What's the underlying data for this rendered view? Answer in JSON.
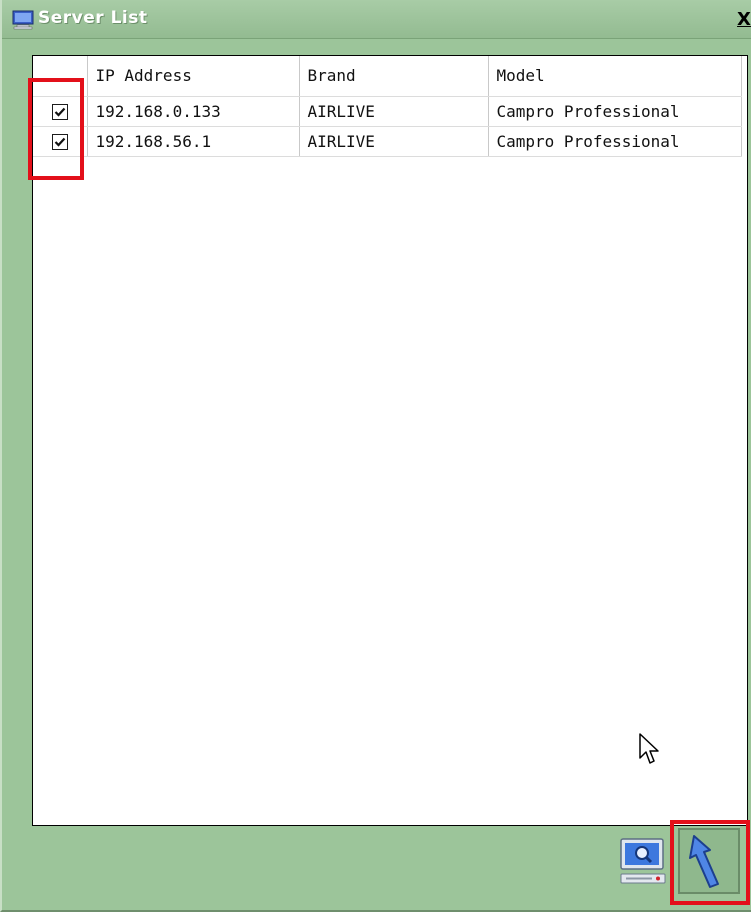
{
  "window": {
    "title": "Server List",
    "close_label": "X"
  },
  "table": {
    "columns": [
      "",
      "IP Address",
      "Brand",
      "Model"
    ],
    "rows": [
      {
        "checked": true,
        "ip": "192.168.0.133",
        "brand": "AIRLIVE",
        "model": "Campro Professional"
      },
      {
        "checked": true,
        "ip": "192.168.56.1",
        "brand": "AIRLIVE",
        "model": "Campro Professional"
      }
    ]
  },
  "toolbar": {
    "search_icon": "monitor-search-icon",
    "back_icon": "back-arrow-icon"
  },
  "colors": {
    "background": "#9cc59a",
    "highlight": "#e3101a",
    "accent_blue": "#4f86e6"
  }
}
